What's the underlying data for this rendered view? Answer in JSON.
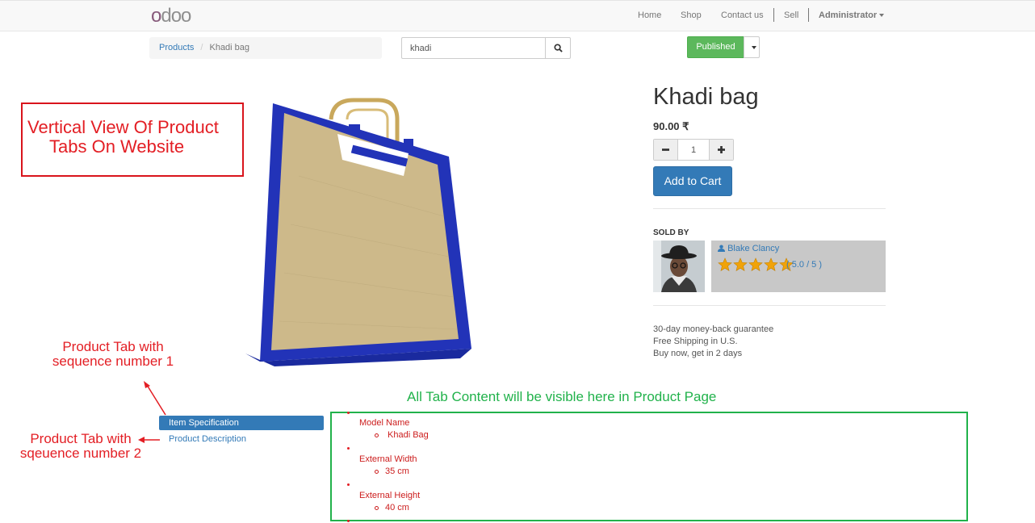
{
  "nav": {
    "logo": "odoo",
    "links": [
      "Home",
      "Shop",
      "Contact us",
      "Sell"
    ],
    "user": "Administrator"
  },
  "breadcrumb": {
    "parent": "Products",
    "current": "Khadi bag"
  },
  "search": {
    "value": "khadi"
  },
  "publish": {
    "label": "Published"
  },
  "annotations": {
    "title_line1": "Vertical View Of Product",
    "title_line2": "Tabs On Website",
    "tab1_line1": "Product Tab with",
    "tab1_line2": "sequence number 1",
    "tab2_line1": "Product Tab with",
    "tab2_line2": "sqeuence number 2",
    "content_note": "All Tab Content will be visible here in Product Page"
  },
  "product": {
    "name": "Khadi bag",
    "price": "90.00 ₹",
    "quantity": "1",
    "add_to_cart": "Add to Cart",
    "sold_by": "SOLD BY",
    "seller": "Blake Clancy",
    "rating": "( 5.0 / 5 )",
    "rating_value": 5,
    "info": [
      "30-day money-back guarantee",
      "Free Shipping in U.S.",
      "Buy now, get in 2 days"
    ]
  },
  "tabs": [
    {
      "label": "Item Specification",
      "active": true
    },
    {
      "label": "Product Description",
      "active": false
    }
  ],
  "specs": [
    {
      "name": "Model Name",
      "value": "Khadi Bag"
    },
    {
      "name": "External Width",
      "value": "35 cm"
    },
    {
      "name": "External Height",
      "value": "40 cm"
    }
  ],
  "colors": {
    "primary": "#337ab7",
    "success": "#5cb85c",
    "annotation_red": "#e31e24",
    "annotation_green": "#21b24b",
    "star": "#f0a30a"
  }
}
